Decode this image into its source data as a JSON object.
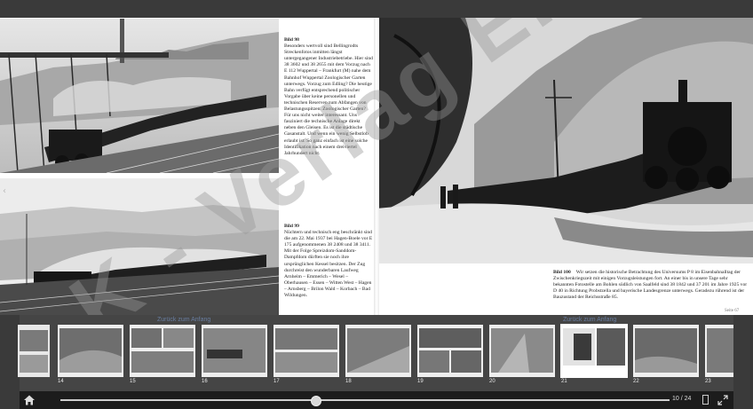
{
  "document": {
    "watermark_text": "K - Verlag EK -",
    "left_page": {
      "bild98": {
        "head": "Bild 98",
        "text": "Besonders wertvoll sind Bellingrodts Streckenfotos inmitten längst untergegangener Industriebetriebe. Hier sind 38 3602 und 38 2655 mit dem Vorzug nach E 112 Wuppertal – Frankfurt (M) nahe dem Bahnhof Wuppertal Zoologischer Garten unterwegs. Vorzug zum Edling? Die heutige Bahn verfügt entsprechend politischer Vorgabe über keine personellen und technischen Reserven zum Abfangen von Belastungsspitzen. Zoologischer Garten? Für uns nicht weiter interessant. Uns fasziniert die technische Anlage direkt neben den Gleisen. Es ist die städtische Gasanstalt. Und wenn ein wenig Selbstlob erlaubt ist: So ganz einfach ist eine solche Identifikation nach einem dreiviertel Jahrhundert nicht."
      },
      "bild99": {
        "head": "Bild 99",
        "text": "Nüchtern und technisch eng beschränkt sind die am 22. Mai 1937 bei Hagen-Boele vor E 175 aufgenommenen 38 2408 und 38 3411. Mit der Folge Spreizdom-Sanddom-Dampfdom dürften sie noch ihre ursprünglichen Kessel besitzen. Der Zug durchreist den wunderbaren Laufweg Arnheim – Emmerich – Wesel – Oberhausen – Essen – Witten West – Hagen – Arnsberg – Brilon Wald – Korbach – Bad Wildungen."
      }
    },
    "right_page": {
      "bild100": {
        "head": "Bild 100",
        "text": "Wir setzen die historische Betrachtung des Universums P 8 im Eisenbahnalltag der Zwischenkriegszeit mit einigen Vorzugsleistungen fort. An einer bis in unsere Tage sehr bekannten Fotostelle am Bohlen südlich von Saalfeld sind 38 1842 und 37 201 im Jahre 1925 vor D 40 in Richtung Probstzella und bayerische Landesgrenze unterwegs. Geradezu rührend ist der Bauzustand der Reichsstraße 85."
      },
      "page_number": "Seite 67"
    }
  },
  "thumbnails": {
    "labels": [
      "Zurück zum Anfang",
      "Zurück zum Anfang"
    ],
    "items": [
      {
        "num": "14"
      },
      {
        "num": "15"
      },
      {
        "num": "16"
      },
      {
        "num": "17"
      },
      {
        "num": "18"
      },
      {
        "num": "19"
      },
      {
        "num": "20"
      },
      {
        "num": "21",
        "active": true
      },
      {
        "num": "22"
      },
      {
        "num": "23"
      }
    ]
  },
  "toolbar": {
    "page_counter": "10 / 24",
    "home_icon": "home-icon",
    "progress": 0.42
  }
}
